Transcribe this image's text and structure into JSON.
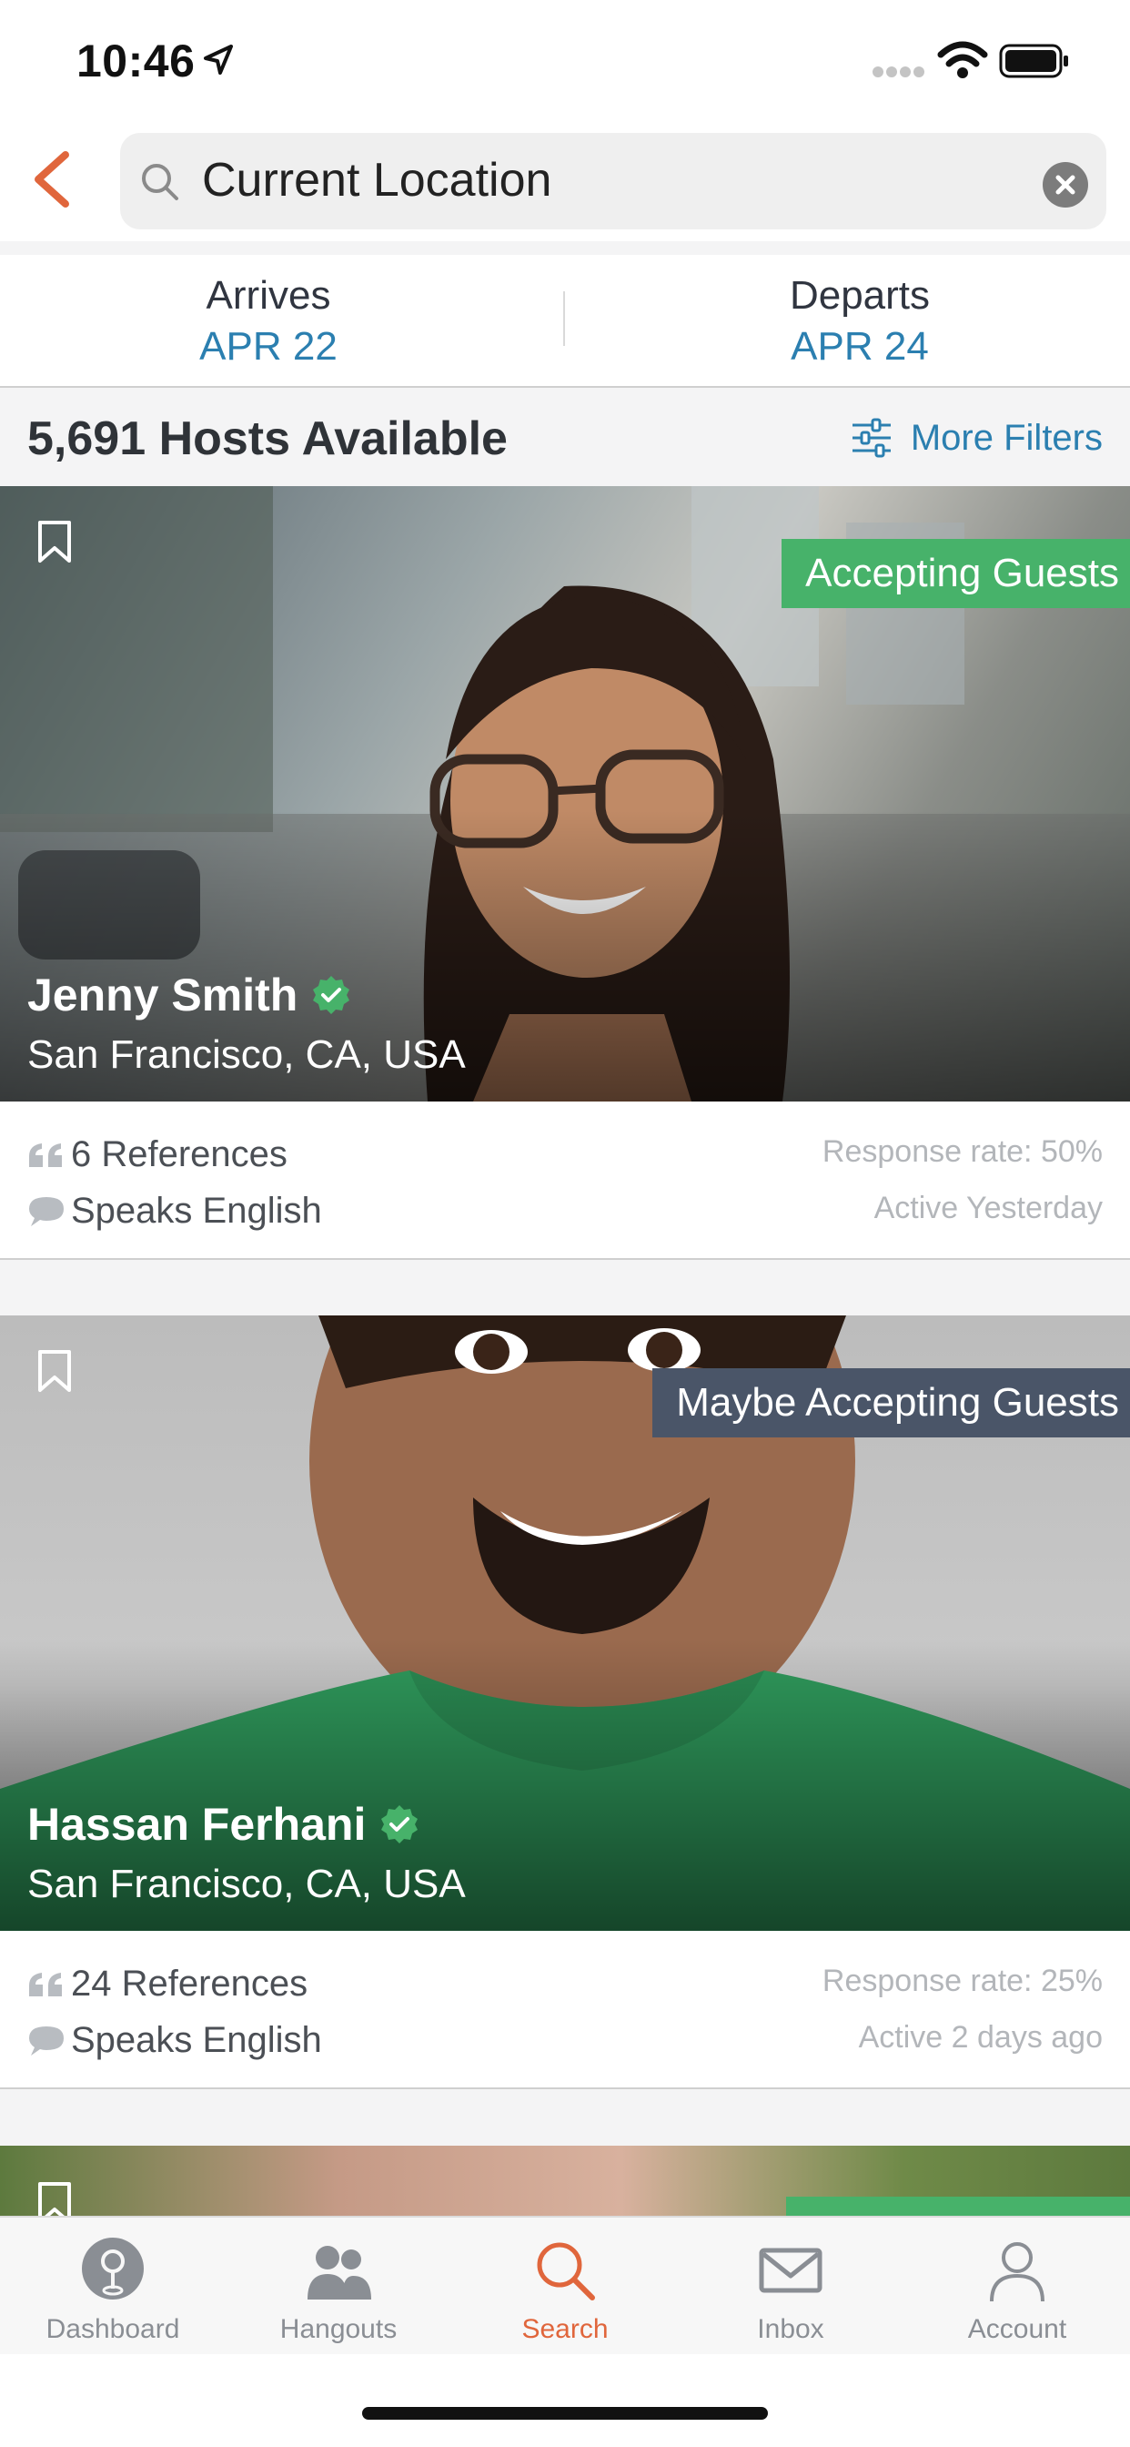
{
  "status_bar": {
    "time": "10:46"
  },
  "search": {
    "query": "Current Location"
  },
  "dates": {
    "arrives_label": "Arrives",
    "arrives_value": "APR 22",
    "departs_label": "Departs",
    "departs_value": "APR 24"
  },
  "summary": {
    "hosts_count": "5,691 Hosts Available",
    "filters_label": "More Filters"
  },
  "hosts": [
    {
      "name": "Jenny Smith",
      "location": "San Francisco, CA, USA",
      "status": "Accepting Guests",
      "references": "6 References",
      "languages": "Speaks English",
      "response_rate": "Response rate: 50%",
      "last_active": "Active Yesterday"
    },
    {
      "name": "Hassan Ferhani",
      "location": "San Francisco, CA, USA",
      "status": "Maybe Accepting Guests",
      "references": "24 References",
      "languages": "Speaks English",
      "response_rate": "Response rate: 25%",
      "last_active": "Active 2 days ago"
    }
  ],
  "tabs": [
    {
      "label": "Dashboard",
      "icon": "dashboard-pin-icon"
    },
    {
      "label": "Hangouts",
      "icon": "people-icon"
    },
    {
      "label": "Search",
      "icon": "search-icon",
      "active": true
    },
    {
      "label": "Inbox",
      "icon": "envelope-icon"
    },
    {
      "label": "Account",
      "icon": "person-icon"
    }
  ],
  "colors": {
    "accent": "#e0663c",
    "link": "#2b7fb0",
    "accepting": "#47b26a",
    "maybe": "#4a5568"
  }
}
